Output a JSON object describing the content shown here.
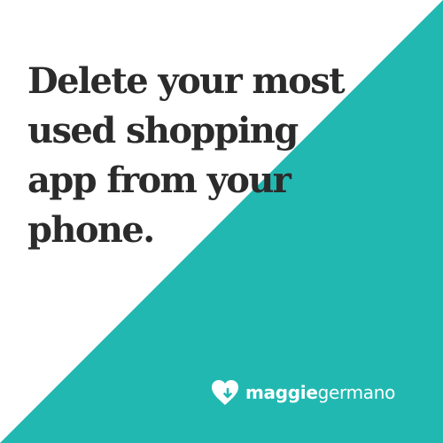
{
  "colors": {
    "background": "#ffffff",
    "accent": "#22b8b2",
    "text": "#2b2b2b",
    "logo": "#ffffff"
  },
  "headline": {
    "lines": [
      "Delete your most",
      "used shopping",
      "app from your",
      "phone."
    ]
  },
  "logo": {
    "icon": "heart-icon",
    "first": "maggie",
    "last": "germano"
  }
}
